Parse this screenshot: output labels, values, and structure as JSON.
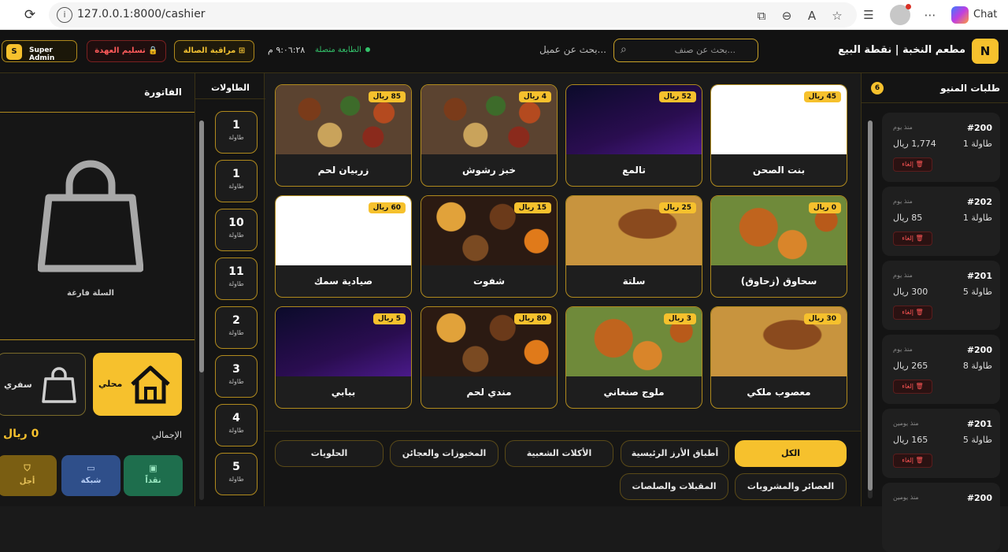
{
  "browser": {
    "url": "127.0.0.1:8000/cashier",
    "chat_label": "Chat"
  },
  "header": {
    "brand_letter": "N",
    "brand_title": "مطعم النخبة | نقطة البيع",
    "item_search_placeholder": "...بحث عن صنف",
    "customer_search_placeholder": "...بحث عن عميل",
    "printer_status": "الطابعة متصلة",
    "clock": "٩:٠٦:٢٨ م",
    "monitor_hall_label": "مراقبة الصالة",
    "handover_label": "تسليم العهدة",
    "admin_initial": "S",
    "admin_name": "Super Admin"
  },
  "orders_panel": {
    "title": "طلبات المنيو",
    "count": "6",
    "cancel_label": "إلغاء",
    "orders": [
      {
        "number": "#200",
        "time_ago": "منذ يوم",
        "table": "طاولة 1",
        "amount": "1,774 ريال"
      },
      {
        "number": "#202",
        "time_ago": "منذ يوم",
        "table": "طاولة 1",
        "amount": "85 ريال"
      },
      {
        "number": "#201",
        "time_ago": "منذ يوم",
        "table": "طاولة 5",
        "amount": "300 ريال"
      },
      {
        "number": "#200",
        "time_ago": "منذ يوم",
        "table": "طاولة 8",
        "amount": "265 ريال"
      },
      {
        "number": "#201",
        "time_ago": "منذ يومين",
        "table": "طاولة 5",
        "amount": "165 ريال"
      },
      {
        "number": "#200",
        "time_ago": "منذ يومين",
        "table": "",
        "amount": ""
      }
    ]
  },
  "products": [
    {
      "name": "بنت الصحن",
      "price": "45 ريال",
      "image": "burger"
    },
    {
      "name": "تالمع",
      "price": "52 ريال",
      "image": "code"
    },
    {
      "name": "خبز رشوش",
      "price": "4 ريال",
      "image": "food"
    },
    {
      "name": "زربيان لحم",
      "price": "85 ريال",
      "image": "food"
    },
    {
      "name": "سحاوق (زحاوق)",
      "price": "0 ريال",
      "image": "fried"
    },
    {
      "name": "سلتة",
      "price": "25 ريال",
      "image": "rice"
    },
    {
      "name": "شفوت",
      "price": "15 ريال",
      "image": "stew"
    },
    {
      "name": "صيادية سمك",
      "price": "60 ريال",
      "image": "burger"
    },
    {
      "name": "معصوب ملكي",
      "price": "30 ريال",
      "image": "rice"
    },
    {
      "name": "ملوج صنعاني",
      "price": "3 ريال",
      "image": "fried"
    },
    {
      "name": "مندي لحم",
      "price": "80 ريال",
      "image": "stew"
    },
    {
      "name": "ببابي",
      "price": "5 ريال",
      "image": "code"
    }
  ],
  "categories": [
    {
      "label": "الكل",
      "active": true
    },
    {
      "label": "أطباق الأرز الرئيسية",
      "active": false
    },
    {
      "label": "الأكلات الشعبية",
      "active": false
    },
    {
      "label": "المخبوزات والعجائن",
      "active": false
    },
    {
      "label": "الحلويات",
      "active": false
    },
    {
      "label": "العصائر والمشروبات",
      "active": false
    },
    {
      "label": "المقبلات والصلصات",
      "active": false
    }
  ],
  "tables_panel": {
    "title": "الطاولات",
    "table_word": "طاولة",
    "tables": [
      "1",
      "1",
      "10",
      "11",
      "2",
      "3",
      "4",
      "5"
    ]
  },
  "invoice": {
    "title": "الفاتورة",
    "empty_text": "السلة فارغة",
    "local_label": "محلي",
    "takeaway_label": "سفري",
    "total_label": "الإجمالي",
    "total_value": "0 ريال",
    "pay_cash": "نقداً",
    "pay_network": "شبكة",
    "pay_later": "أجل"
  },
  "colors": {
    "accent": "#f6c12d",
    "background": "#1a1a1a",
    "danger": "#ff5a5a",
    "success": "#33c36b"
  }
}
